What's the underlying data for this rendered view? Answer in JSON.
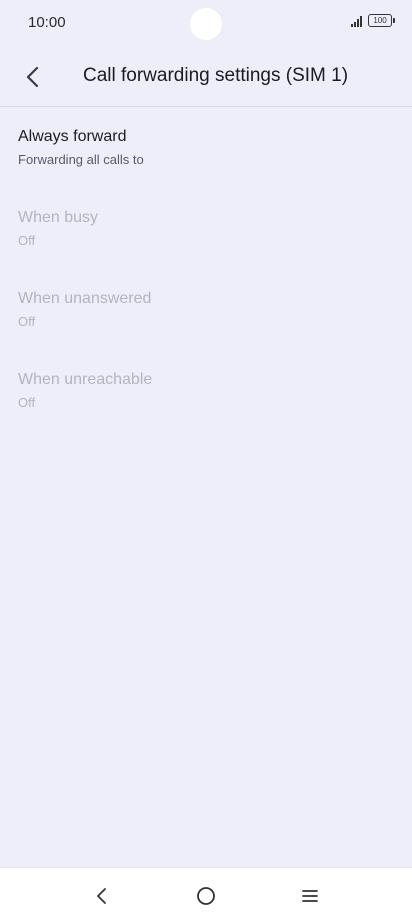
{
  "status_bar": {
    "time": "10:00",
    "battery": "100"
  },
  "header": {
    "title": "Call forwarding settings (SIM 1)"
  },
  "settings": [
    {
      "title": "Always forward",
      "summary": "Forwarding all calls to",
      "enabled": true
    },
    {
      "title": "When busy",
      "summary": "Off",
      "enabled": false
    },
    {
      "title": "When unanswered",
      "summary": "Off",
      "enabled": false
    },
    {
      "title": "When unreachable",
      "summary": "Off",
      "enabled": false
    }
  ],
  "icons": {
    "back": "chevron-left-icon",
    "signal": "signal-icon",
    "battery": "battery-icon",
    "nav_back": "nav-back-icon",
    "nav_home": "nav-home-icon",
    "nav_recents": "nav-recents-icon"
  },
  "colors": {
    "background": "#eeeefa",
    "text_primary": "#1c1c1e",
    "text_disabled": "#b4b4bc",
    "nav_background": "#ffffff"
  }
}
